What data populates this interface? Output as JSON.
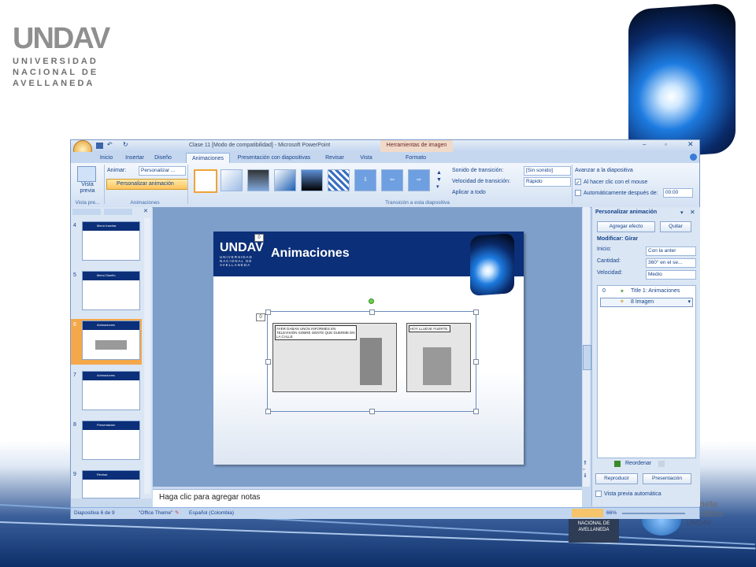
{
  "background": {
    "logo": {
      "brand": "UNDAV",
      "line1": "UNIVERSIDAD",
      "line2": "NACIONAL DE",
      "line3": "AVELLANEDA"
    },
    "gabinete": {
      "line1": "abinete",
      "line2": "ormático",
      "line3": "UNDAV"
    }
  },
  "window": {
    "title": "Clase 11 [Modo de compatibilidad] - Microsoft PowerPoint",
    "context_tab": "Herramientas de imagen"
  },
  "tabs": [
    "Inicio",
    "Insertar",
    "Diseño",
    "Animaciones",
    "Presentación con diapositivas",
    "Revisar",
    "Vista",
    "Formato"
  ],
  "ribbon": {
    "preview": {
      "label1": "Vista",
      "label2": "previa",
      "group": "Vista pre..."
    },
    "animations": {
      "animate_label": "Animar:",
      "animate_value": "Personalizar ...",
      "custom_button": "Personalizar animación",
      "group": "Animaciones"
    },
    "transition": {
      "sound_label": "Sonido de transición:",
      "sound_value": "[Sin sonido]",
      "speed_label": "Velocidad de transición:",
      "speed_value": "Rápido",
      "apply_all": "Aplicar a todo",
      "group": "Transición a esta diapositiva"
    },
    "advance": {
      "title": "Avanzar a la diapositiva",
      "on_click": "Al hacer clic con el mouse",
      "auto_after": "Automáticamente después de:",
      "time": "00:00"
    }
  },
  "slides_pane": {
    "slides": [
      {
        "num": "4",
        "title": "Menú Insertar"
      },
      {
        "num": "5",
        "title": "Menú Diseño"
      },
      {
        "num": "6",
        "title": "Animaciones",
        "selected": true
      },
      {
        "num": "7",
        "title": "Animaciones"
      },
      {
        "num": "8",
        "title": "Presentación"
      },
      {
        "num": "9",
        "title": "Revisar"
      }
    ]
  },
  "slide": {
    "brand": "UNDAV",
    "brand_sub1": "UNIVERSIDAD",
    "brand_sub2": "NACIONAL DE",
    "brand_sub3": "AVELLANEDA",
    "title": "Animaciones",
    "tag_title": "0",
    "tag_image": "0",
    "comic1": "AYER DABAN UNOS INFORMES EN TELEVISIÓN SOBRE GENTE QUE DUERME EN LA CALLE",
    "comic2": "HOY LLUEVE FUERTE."
  },
  "notes_placeholder": "Haga clic para agregar notas",
  "task_pane": {
    "title": "Personalizar animación",
    "add_effect": "Agregar efecto",
    "remove": "Quitar",
    "modify_label": "Modificar: Girar",
    "start_label": "Inicio:",
    "start_value": "Con la anter",
    "amount_label": "Cantidad:",
    "amount_value": "360° en el se...",
    "speed_label": "Velocidad:",
    "speed_value": "Medio",
    "list": [
      {
        "order": "0",
        "text": "Title 1: Animaciones"
      },
      {
        "order": "",
        "text": "8 Imagen"
      }
    ],
    "reorder": "Reordenar",
    "play": "Reproducir",
    "slideshow": "Presentación",
    "autopreview": "Vista previa automática"
  },
  "status_bar": {
    "slide_info": "Diapositiva 6 de 9",
    "theme": "\"Office Theme\"",
    "language": "Español (Colombia)",
    "zoom": "66%"
  }
}
